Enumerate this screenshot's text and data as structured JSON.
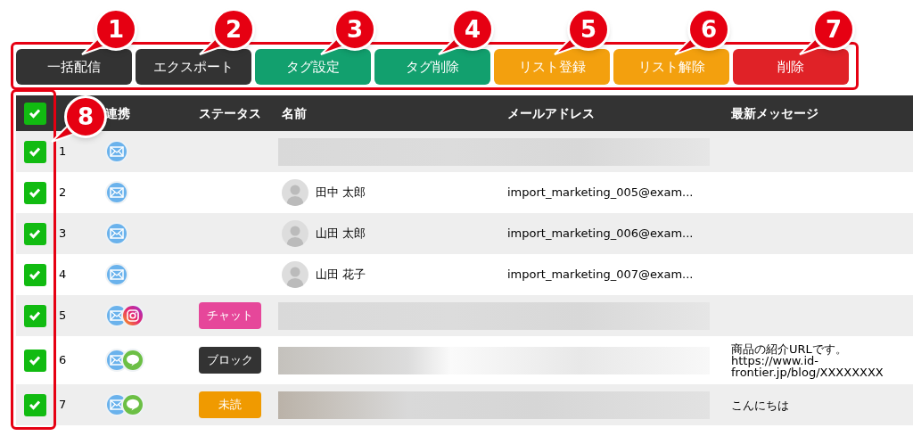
{
  "toolbar": {
    "buttons": [
      {
        "label": "一括配信",
        "color": "#333333"
      },
      {
        "label": "エクスポート",
        "color": "#333333"
      },
      {
        "label": "タグ設定",
        "color": "#12a06e"
      },
      {
        "label": "タグ削除",
        "color": "#12a06e"
      },
      {
        "label": "リスト登録",
        "color": "#f3a00e"
      },
      {
        "label": "リスト解除",
        "color": "#f3a00e"
      },
      {
        "label": "削除",
        "color": "#e02227"
      }
    ]
  },
  "callouts": [
    "1",
    "2",
    "3",
    "4",
    "5",
    "6",
    "7",
    "8"
  ],
  "table": {
    "header_checked": true,
    "columns": [
      "連携",
      "ステータス",
      "名前",
      "メールアドレス",
      "最新メッセージ"
    ],
    "rows": [
      {
        "checked": true,
        "no": "1",
        "channels": [
          {
            "kind": "mail"
          }
        ],
        "redacted": true
      },
      {
        "checked": true,
        "no": "2",
        "channels": [
          {
            "kind": "mail"
          }
        ],
        "name": "田中 太郎",
        "email": "import_marketing_005@exam..."
      },
      {
        "checked": true,
        "no": "3",
        "channels": [
          {
            "kind": "mail"
          }
        ],
        "name": "山田 太郎",
        "email": "import_marketing_006@exam..."
      },
      {
        "checked": true,
        "no": "4",
        "channels": [
          {
            "kind": "mail"
          }
        ],
        "name": "山田 花子",
        "email": "import_marketing_007@exam..."
      },
      {
        "checked": true,
        "no": "5",
        "channels": [
          {
            "kind": "mail"
          },
          {
            "kind": "instagram"
          }
        ],
        "status": {
          "label": "チャット",
          "color": "#e6479a"
        },
        "redacted": true
      },
      {
        "checked": true,
        "no": "6",
        "channels": [
          {
            "kind": "mail"
          },
          {
            "kind": "line"
          }
        ],
        "status": {
          "label": "ブロック",
          "color": "#333333"
        },
        "redacted": true,
        "message": "商品の紹介URLです。\nhttps://www.id-\nfrontier.jp/blog/XXXXXXXX"
      },
      {
        "checked": true,
        "no": "7",
        "channels": [
          {
            "kind": "mail"
          },
          {
            "kind": "line"
          }
        ],
        "status": {
          "label": "未読",
          "color": "#f09a00"
        },
        "redacted": true,
        "message": "こんにちは"
      }
    ]
  }
}
